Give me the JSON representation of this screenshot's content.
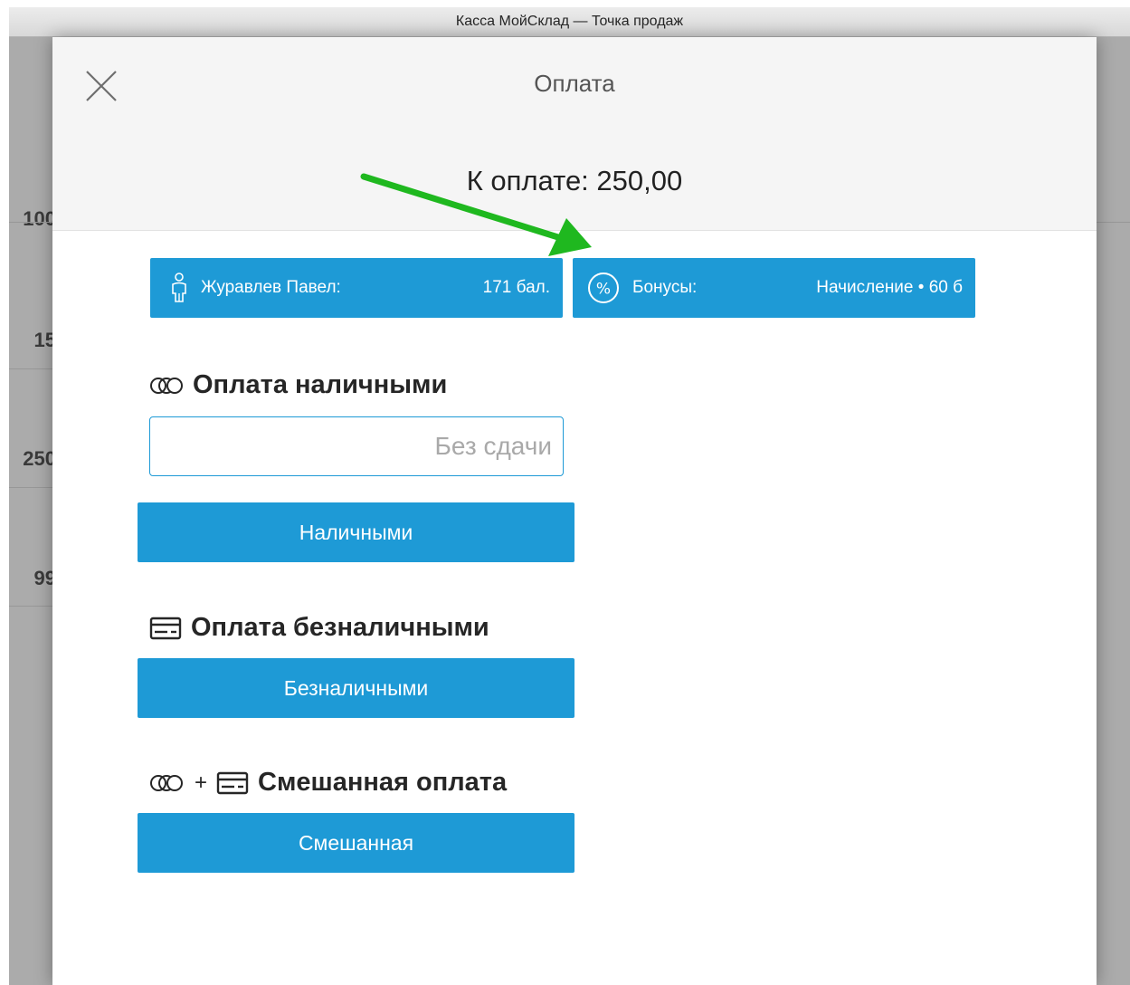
{
  "window": {
    "title": "Касса МойСклад — Точка продаж"
  },
  "background": {
    "rows": [
      "100",
      "15",
      "250",
      "99"
    ]
  },
  "modal": {
    "title": "Оплата",
    "amount": "К оплате: 250,00",
    "close_icon": "close-icon"
  },
  "customer": {
    "name": "Журавлев Павел:",
    "points": "171 бал.",
    "icon": "person-icon"
  },
  "bonus": {
    "label": "Бонусы:",
    "value": "Начисление • 60 б",
    "icon": "percent-icon"
  },
  "cash": {
    "title": "Оплата наличными",
    "icon": "coins-icon",
    "placeholder": "Без сдачи",
    "button": "Наличными"
  },
  "card": {
    "title": "Оплата безналичными",
    "icon": "card-icon",
    "button": "Безналичными"
  },
  "mixed": {
    "title": "Смешанная оплата",
    "plus": "+",
    "button": "Смешанная"
  },
  "annotation": {
    "arrow_color": "#1fb81f"
  },
  "colors": {
    "accent": "#1e9ad6"
  }
}
